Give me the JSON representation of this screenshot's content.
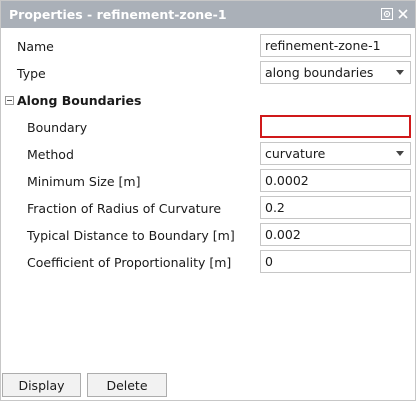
{
  "panel": {
    "title": "Properties - refinement-zone-1",
    "icons": [
      "settings-icon",
      "close-icon"
    ]
  },
  "fields": {
    "name": {
      "label": "Name",
      "value": "refinement-zone-1"
    },
    "type": {
      "label": "Type",
      "value": "along boundaries"
    }
  },
  "group": {
    "label": "Along Boundaries",
    "expanded": true,
    "items": {
      "boundary": {
        "label": "Boundary",
        "value": ""
      },
      "method": {
        "label": "Method",
        "value": "curvature"
      },
      "min_size": {
        "label": "Minimum Size [m]",
        "value": "0.0002"
      },
      "fraction": {
        "label": "Fraction of Radius of Curvature",
        "value": "0.2"
      },
      "typical_distance": {
        "label": "Typical Distance to Boundary [m]",
        "value": "0.002"
      },
      "coefficient": {
        "label": "Coefficient of Proportionality [m]",
        "value": "0"
      }
    }
  },
  "buttons": {
    "display": "Display",
    "delete": "Delete"
  },
  "colors": {
    "titlebar": "#aab0b8",
    "error_border": "#d0191a"
  }
}
